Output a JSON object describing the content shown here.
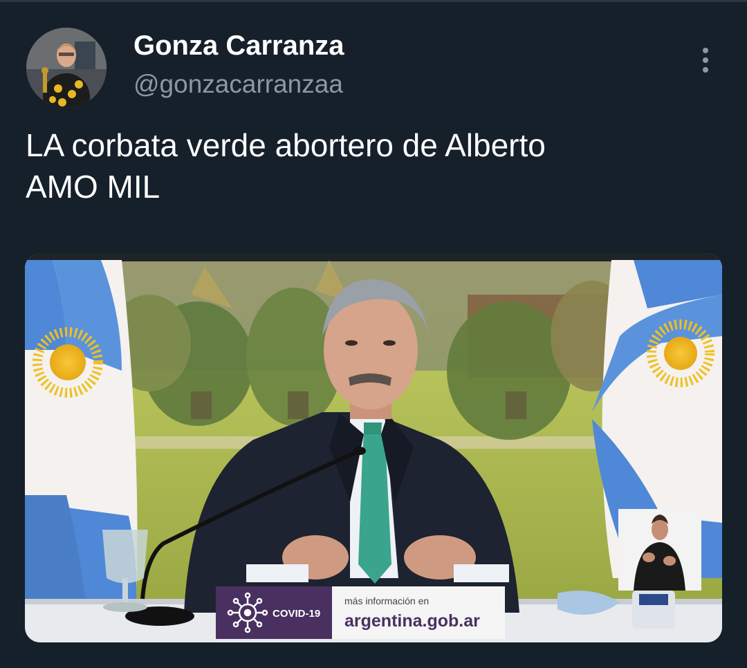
{
  "author": {
    "display_name": "Gonza Carranza",
    "handle": "@gonzacarranzaa",
    "avatar_icon": "profile-photo"
  },
  "tweet": {
    "text_line1": "LA corbata verde abortero de Alberto",
    "text_line2": "AMO MIL",
    "more_icon": "more-vertical-icon"
  },
  "media": {
    "banner_left_label": "COVID-19",
    "banner_right_small": "más información en",
    "banner_right_url": "argentina.gob.ar",
    "colors": {
      "flag_blue": "#4f88d6",
      "flag_white": "#f4f1ef",
      "sun_yellow": "#f0c020",
      "tie": "#3aa58c",
      "banner_purple": "#4a3060"
    }
  }
}
